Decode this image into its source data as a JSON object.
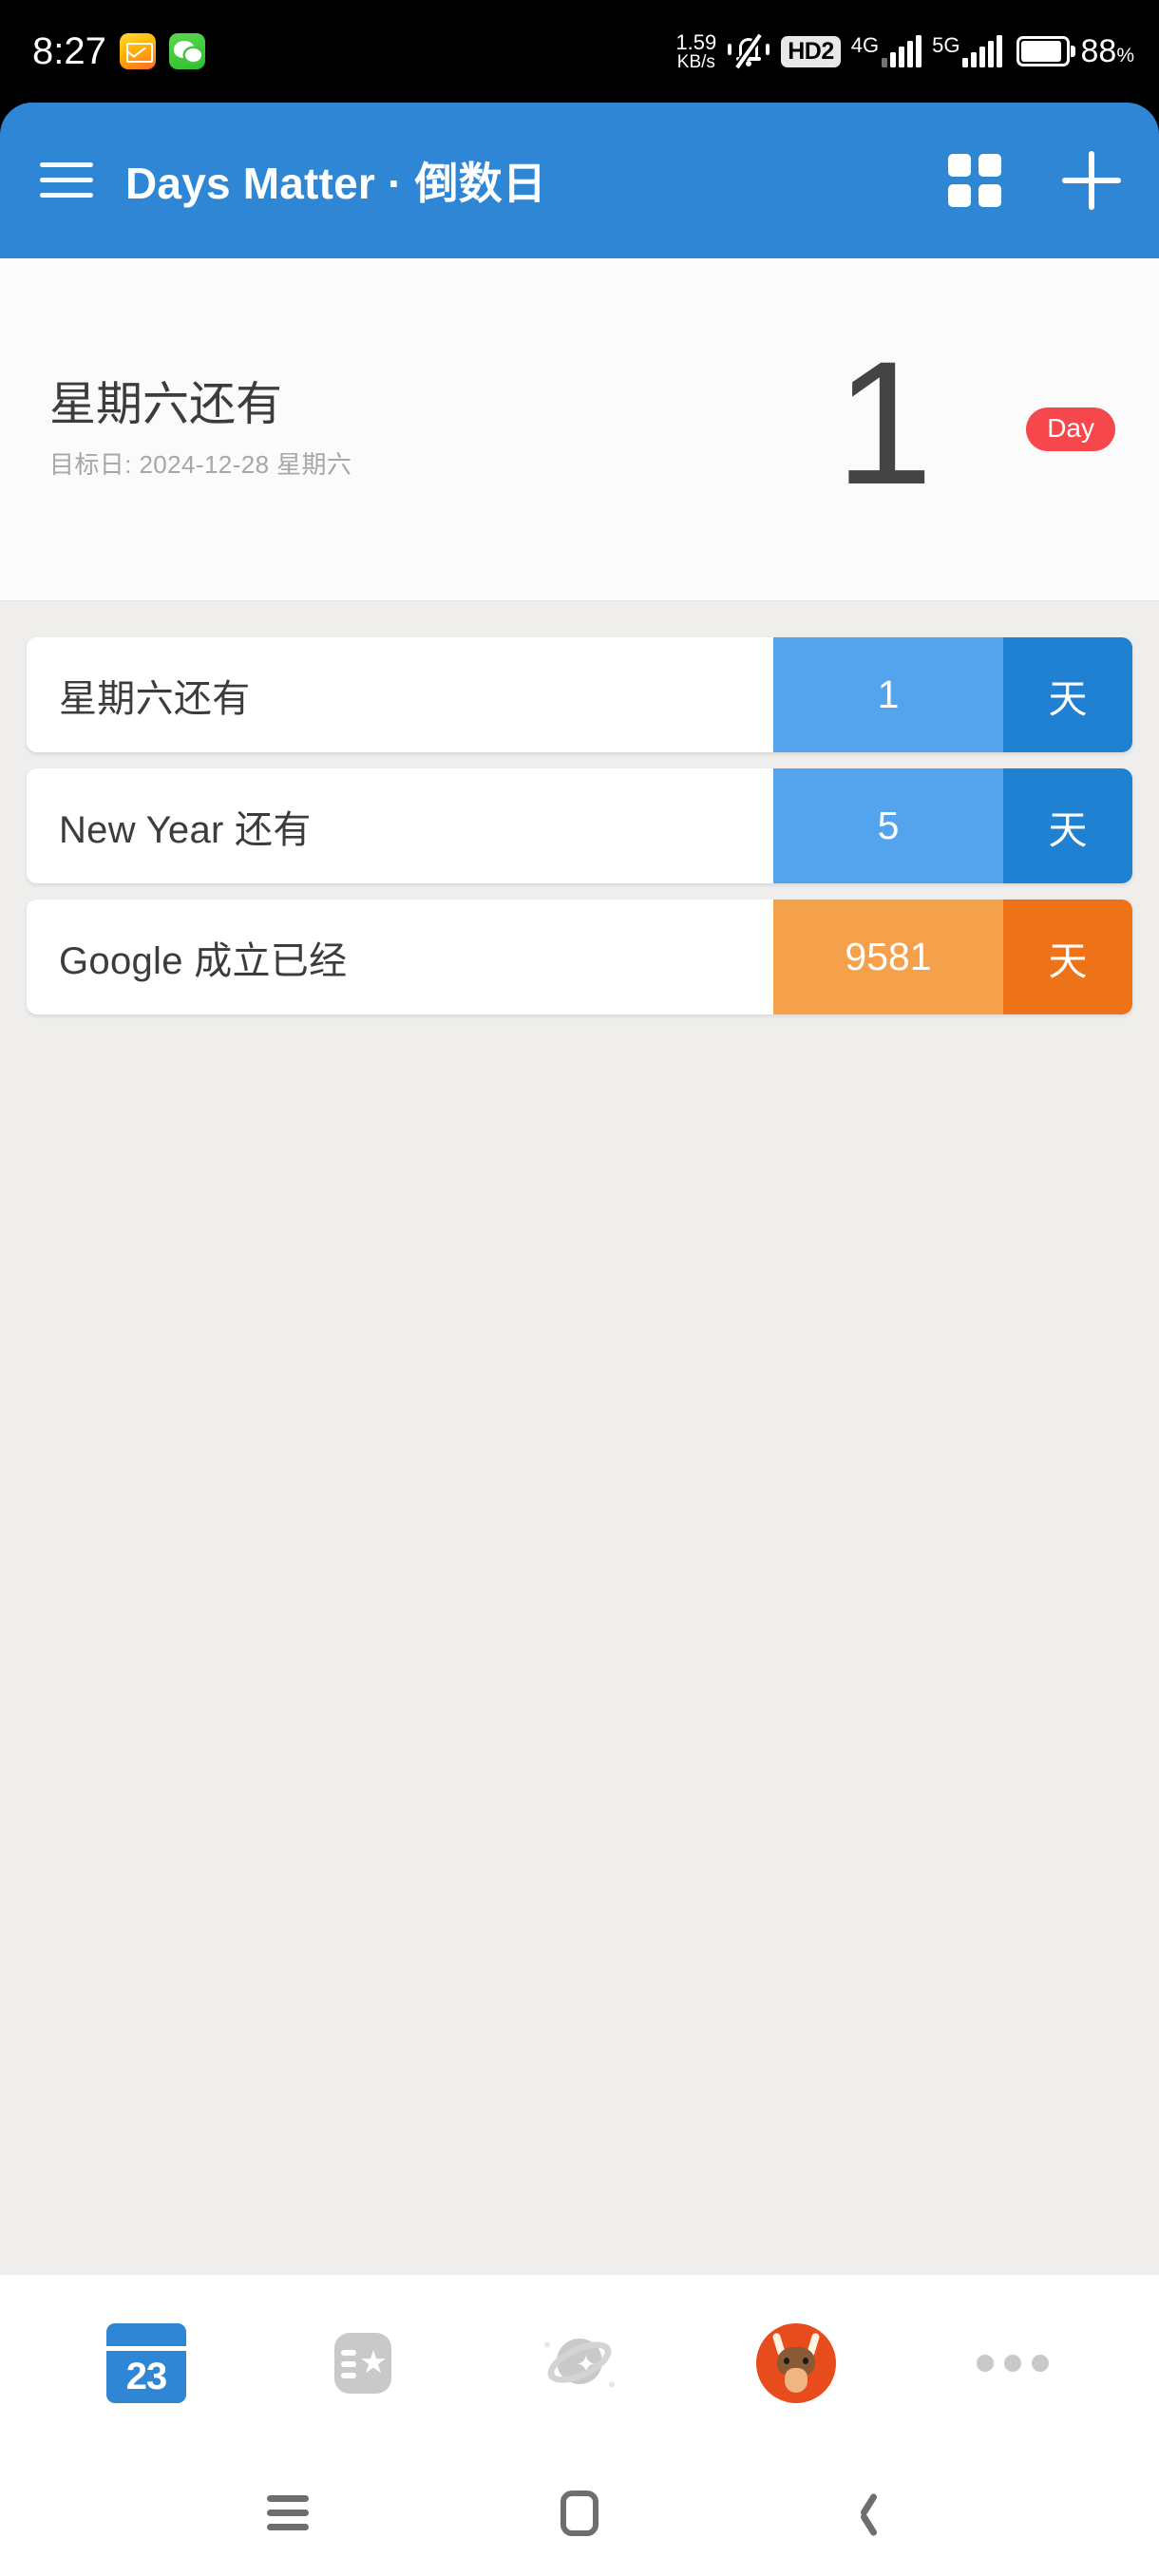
{
  "status_bar": {
    "time": "8:27",
    "icons": [
      "mail-icon",
      "wechat-icon"
    ],
    "net_speed_value": "1.59",
    "net_speed_unit": "KB/s",
    "vibrate_icon": "vibrate-off-icon",
    "hd_label": "HD2",
    "sim1_network": "4G",
    "sim2_network": "5G",
    "battery_percent": "88",
    "battery_percent_symbol": "%"
  },
  "app_bar": {
    "menu_icon": "hamburger-menu-icon",
    "title": "Days Matter · 倒数日",
    "grid_icon": "grid-view-icon",
    "add_icon": "add-plus-icon",
    "background_color": "#2E86D4"
  },
  "header_card": {
    "title": "星期六还有",
    "subtitle": "目标日: 2024-12-28 星期六",
    "number": "1",
    "badge": "Day",
    "badge_color": "#F6484C"
  },
  "list": {
    "items": [
      {
        "title": "星期六还有",
        "number": "1",
        "unit": "天",
        "num_bg": "#53A3ED",
        "unit_bg": "#2080D1"
      },
      {
        "title": "New Year 还有",
        "number": "5",
        "unit": "天",
        "num_bg": "#53A3ED",
        "unit_bg": "#2080D1"
      },
      {
        "title": "Google 成立已经",
        "number": "9581",
        "unit": "天",
        "num_bg": "#F5A04B",
        "unit_bg": "#EE7217"
      }
    ]
  },
  "dock": {
    "items": [
      {
        "name": "calendar-23-icon",
        "label": "23",
        "active": true
      },
      {
        "name": "ticket-star-icon",
        "label": ""
      },
      {
        "name": "planet-saturn-icon",
        "label": ""
      },
      {
        "name": "ox-mascot-icon",
        "label": ""
      },
      {
        "name": "more-dots-icon",
        "label": ""
      }
    ]
  },
  "nav_bar": {
    "recents_icon": "recents-icon",
    "home_icon": "home-icon",
    "back_icon": "back-icon"
  }
}
